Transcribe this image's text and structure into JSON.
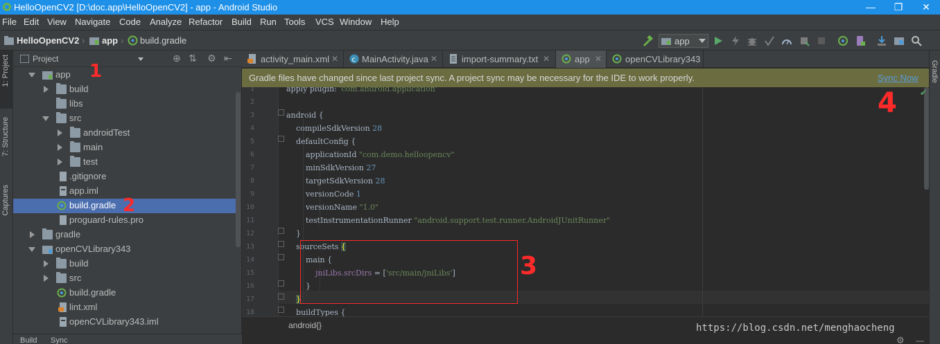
{
  "window": {
    "title": "HelloOpenCV2 [D:\\doc.app\\HelloOpenCV2] - app - Android Studio"
  },
  "menu": [
    "File",
    "Edit",
    "View",
    "Navigate",
    "Code",
    "Analyze",
    "Refactor",
    "Build",
    "Run",
    "Tools",
    "VCS",
    "Window",
    "Help"
  ],
  "breadcrumb": {
    "project": "HelloOpenCV2",
    "module": "app",
    "file": "build.gradle"
  },
  "toolbar": {
    "run_config": "app"
  },
  "side_tools": {
    "project": "1: Project",
    "structure": "7: Structure",
    "captures": "Captures",
    "gradle": "Gradle"
  },
  "project_panel": {
    "view": "Project",
    "tree": [
      {
        "label": "app",
        "expanded": true,
        "type": "module"
      },
      {
        "label": "build",
        "expanded": false,
        "type": "folder"
      },
      {
        "label": "libs",
        "type": "folder"
      },
      {
        "label": "src",
        "expanded": true,
        "type": "folder"
      },
      {
        "label": "androidTest",
        "expanded": false,
        "type": "folder"
      },
      {
        "label": "main",
        "expanded": false,
        "type": "folder"
      },
      {
        "label": "test",
        "expanded": false,
        "type": "folder"
      },
      {
        "label": ".gitignore",
        "type": "file"
      },
      {
        "label": "app.iml",
        "type": "file"
      },
      {
        "label": "build.gradle",
        "type": "gradle",
        "selected": true
      },
      {
        "label": "proguard-rules.pro",
        "type": "file"
      },
      {
        "label": "gradle",
        "expanded": false,
        "type": "folder"
      },
      {
        "label": "openCVLibrary343",
        "expanded": true,
        "type": "module"
      },
      {
        "label": "build",
        "expanded": false,
        "type": "folder"
      },
      {
        "label": "src",
        "expanded": false,
        "type": "folder"
      },
      {
        "label": "build.gradle",
        "type": "gradle"
      },
      {
        "label": "lint.xml",
        "type": "file"
      },
      {
        "label": "openCVLibrary343.iml",
        "type": "file"
      }
    ],
    "bottom_tabs": [
      "Build",
      "Sync"
    ]
  },
  "editor_tabs": [
    "activity_main.xml",
    "MainActivity.java",
    "import-summary.txt",
    "app",
    "openCVLibrary343"
  ],
  "notification": {
    "message": "Gradle files have changed since last project sync. A project sync may be necessary for the IDE to work properly.",
    "action": "Sync Now"
  },
  "code": [
    {
      "n": "1",
      "parts": [
        [
          "",
          "apply plugin: "
        ],
        [
          "str",
          "'com.android.application'"
        ]
      ]
    },
    {
      "n": "2",
      "parts": [
        [
          "",
          ""
        ]
      ]
    },
    {
      "n": "3",
      "parts": [
        [
          "",
          "android {"
        ]
      ]
    },
    {
      "n": "4",
      "parts": [
        [
          "",
          "    compileSdkVersion "
        ],
        [
          "num",
          "28"
        ]
      ]
    },
    {
      "n": "5",
      "parts": [
        [
          "",
          "    defaultConfig {"
        ]
      ]
    },
    {
      "n": "6",
      "parts": [
        [
          "",
          "        applicationId "
        ],
        [
          "str",
          "\"com.demo.helloopencv\""
        ]
      ]
    },
    {
      "n": "7",
      "parts": [
        [
          "",
          "        minSdkVersion "
        ],
        [
          "num",
          "27"
        ]
      ]
    },
    {
      "n": "8",
      "parts": [
        [
          "",
          "        targetSdkVersion "
        ],
        [
          "num",
          "28"
        ]
      ]
    },
    {
      "n": "9",
      "parts": [
        [
          "",
          "        versionCode "
        ],
        [
          "num",
          "1"
        ]
      ]
    },
    {
      "n": "10",
      "parts": [
        [
          "",
          "        versionName "
        ],
        [
          "str",
          "\"1.0\""
        ]
      ]
    },
    {
      "n": "11",
      "parts": [
        [
          "",
          "        testInstrumentationRunner "
        ],
        [
          "str",
          "\"android.support.test.runner.AndroidJUnitRunner\""
        ]
      ]
    },
    {
      "n": "12",
      "parts": [
        [
          "",
          "    }"
        ]
      ]
    },
    {
      "n": "13",
      "parts": [
        [
          "",
          "    sourceSets "
        ],
        [
          "hl",
          "{"
        ]
      ]
    },
    {
      "n": "14",
      "parts": [
        [
          "",
          "        main {"
        ]
      ]
    },
    {
      "n": "15",
      "parts": [
        [
          "",
          "            "
        ],
        [
          "fn",
          "jniLibs.srcDirs"
        ],
        [
          "",
          " = ["
        ],
        [
          "str",
          "'src/main/jniLibs'"
        ],
        [
          "",
          "]"
        ]
      ]
    },
    {
      "n": "16",
      "parts": [
        [
          "",
          "        }"
        ]
      ]
    },
    {
      "n": "17",
      "parts": [
        [
          "",
          "    "
        ],
        [
          "hl",
          "}"
        ]
      ]
    },
    {
      "n": "18",
      "parts": [
        [
          "",
          "    buildTypes {"
        ]
      ]
    }
  ],
  "editor_breadcrumb": "android{}",
  "annotations": [
    "1",
    "2",
    "3",
    "4"
  ],
  "watermark": "https://blog.csdn.net/menghaocheng",
  "colors": {
    "title_bar": "#1e90e8",
    "selection": "#4b6eaf",
    "banner": "#6b6d41",
    "annotation": "#ff2a2a"
  }
}
